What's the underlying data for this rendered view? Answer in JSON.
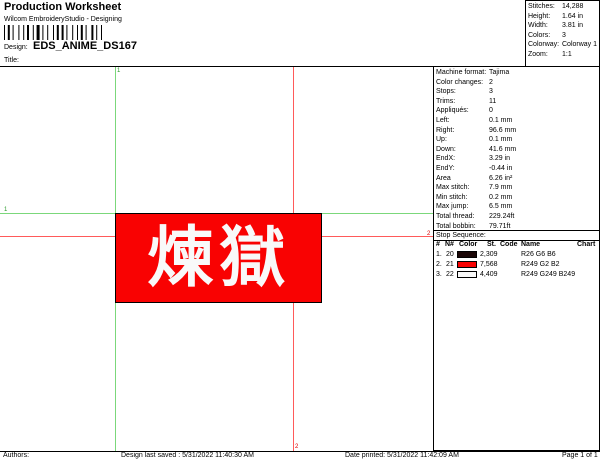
{
  "header": {
    "title": "Production Worksheet",
    "subtitle": "Wilcom EmbroideryStudio - Designing",
    "design_label": "Design:",
    "design_value": "EDS_ANIME_DS167",
    "title_label": "Title:"
  },
  "summary": [
    {
      "label": "Stitches:",
      "value": "14,288"
    },
    {
      "label": "Height:",
      "value": "1.64 in"
    },
    {
      "label": "Width:",
      "value": "3.81 in"
    },
    {
      "label": "Colors:",
      "value": "3"
    },
    {
      "label": "Colorway:",
      "value": "Colorway 1"
    },
    {
      "label": "Zoom:",
      "value": "1:1"
    }
  ],
  "machine": [
    {
      "label": "Machine format:",
      "value": "Tajima"
    },
    {
      "label": "Color changes:",
      "value": "2"
    },
    {
      "label": "Stops:",
      "value": "3"
    },
    {
      "label": "Trims:",
      "value": "11"
    },
    {
      "label": "Appliqués:",
      "value": "0"
    },
    {
      "label": "Left:",
      "value": "0.1 mm"
    },
    {
      "label": "Right:",
      "value": "96.6 mm"
    },
    {
      "label": "Up:",
      "value": "0.1 mm"
    },
    {
      "label": "Down:",
      "value": "41.6 mm"
    },
    {
      "label": "EndX:",
      "value": "3.29 in"
    },
    {
      "label": "EndY:",
      "value": "-0.44 in"
    },
    {
      "label": "Area",
      "value": "6.26 in²"
    },
    {
      "label": "Max stitch:",
      "value": "7.9 mm"
    },
    {
      "label": "Min stitch:",
      "value": "0.2 mm"
    },
    {
      "label": "Max jump:",
      "value": "6.5 mm"
    },
    {
      "label": "Total thread:",
      "value": "229.24ft"
    },
    {
      "label": "Total bobbin:",
      "value": "79.71ft"
    }
  ],
  "stop_sequence": {
    "title": "Stop Sequence:",
    "columns": [
      "#",
      "N#",
      "Color",
      "St.",
      "Code",
      "Name",
      "Chart"
    ],
    "rows": [
      {
        "num": "1.",
        "n": "20",
        "color": "#1a0606",
        "st": "2,309",
        "name": "R26 G6 B6"
      },
      {
        "num": "2.",
        "n": "21",
        "color": "#f90202",
        "st": "7,568",
        "name": "R249 G2 B2"
      },
      {
        "num": "3.",
        "n": "22",
        "color": "#f9f9f9",
        "st": "4,409",
        "name": "R249 G249 B249"
      }
    ]
  },
  "design": {
    "text": "煉獄",
    "background_color": "#f90202",
    "text_color": "#f9f9f9"
  },
  "guides": {
    "g1": "1",
    "g2": "2"
  },
  "footer": {
    "authors": "Authors:",
    "last_saved": "Design last saved : 5/31/2022 11:40:30 AM",
    "printed": "Date printed: 5/31/2022 11:42:09 AM",
    "page": "Page 1 of 1"
  },
  "colors": {
    "accent_red": "#f90202",
    "guide_green": "#7bd87b",
    "guide_red": "#ff5a5a"
  }
}
